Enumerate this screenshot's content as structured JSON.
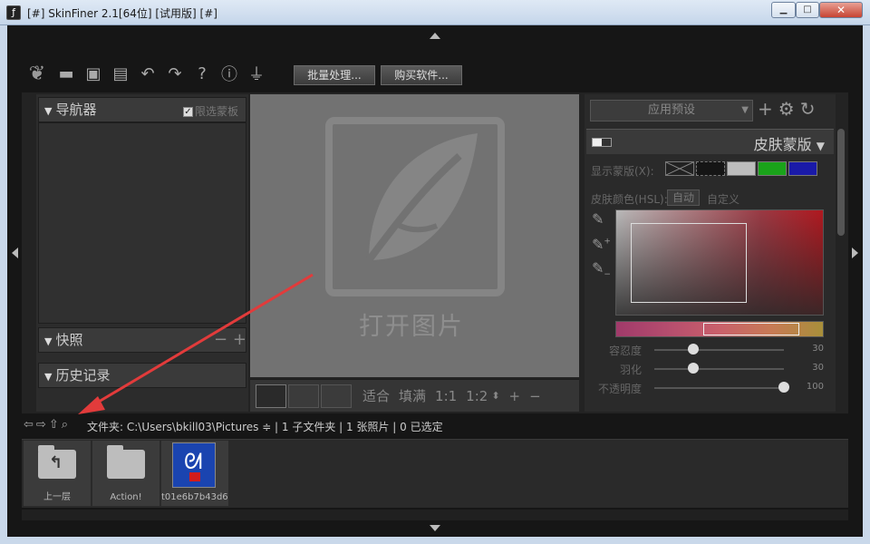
{
  "window": {
    "title": "[#] SkinFiner 2.1[64位] [试用版] [#]",
    "minimize": "▁",
    "maximize": "□",
    "close": "✕"
  },
  "toolbar": {
    "batch_button": "批量处理...",
    "buy_button": "购买软件...",
    "icons": [
      "leaf-logo-icon",
      "folder-open-icon",
      "save-icon",
      "save-as-icon",
      "undo-icon",
      "redo-icon",
      "help-icon",
      "info-icon",
      "plugin-icon"
    ]
  },
  "left_panel": {
    "navigator": {
      "title": "导航器",
      "checkbox_label": "限选蒙板",
      "checked": true
    },
    "snapshots": {
      "title": "快照",
      "minus": "−",
      "plus": "+"
    },
    "history": {
      "title": "历史记录"
    }
  },
  "canvas": {
    "placeholder_text": "打开图片"
  },
  "view_bar": {
    "fit": "适合",
    "fill": "填满",
    "ratio_1": "1:1",
    "ratio_2": "1:2",
    "zoom_in": "+",
    "zoom_out": "−"
  },
  "right_panel": {
    "preset_select": "应用预设",
    "skin_mask": {
      "title": "皮肤蒙版",
      "show_mask_label": "显示蒙版(X):",
      "skin_color_label": "皮肤颜色(HSL):",
      "auto_button": "自动",
      "custom_label": "自定义",
      "swatch_colors": [
        "#222222",
        "#151515",
        "#bdbdbd",
        "#1aa31a",
        "#1a1aa8"
      ],
      "sliders": [
        {
          "name": "容忍度",
          "value": "30",
          "fraction": 0.3
        },
        {
          "name": "羽化",
          "value": "30",
          "fraction": 0.3
        },
        {
          "name": "不透明度",
          "value": "100",
          "fraction": 1.0
        }
      ]
    }
  },
  "path_bar": {
    "text": "文件夹: C:\\Users\\bkill03\\Pictures ≑ | 1 子文件夹 | 1 张照片 | 0 已选定"
  },
  "browser": {
    "items": [
      {
        "label": "上一层"
      },
      {
        "label": "Action!"
      },
      {
        "label": "t01e6b7b43d6..."
      }
    ]
  }
}
